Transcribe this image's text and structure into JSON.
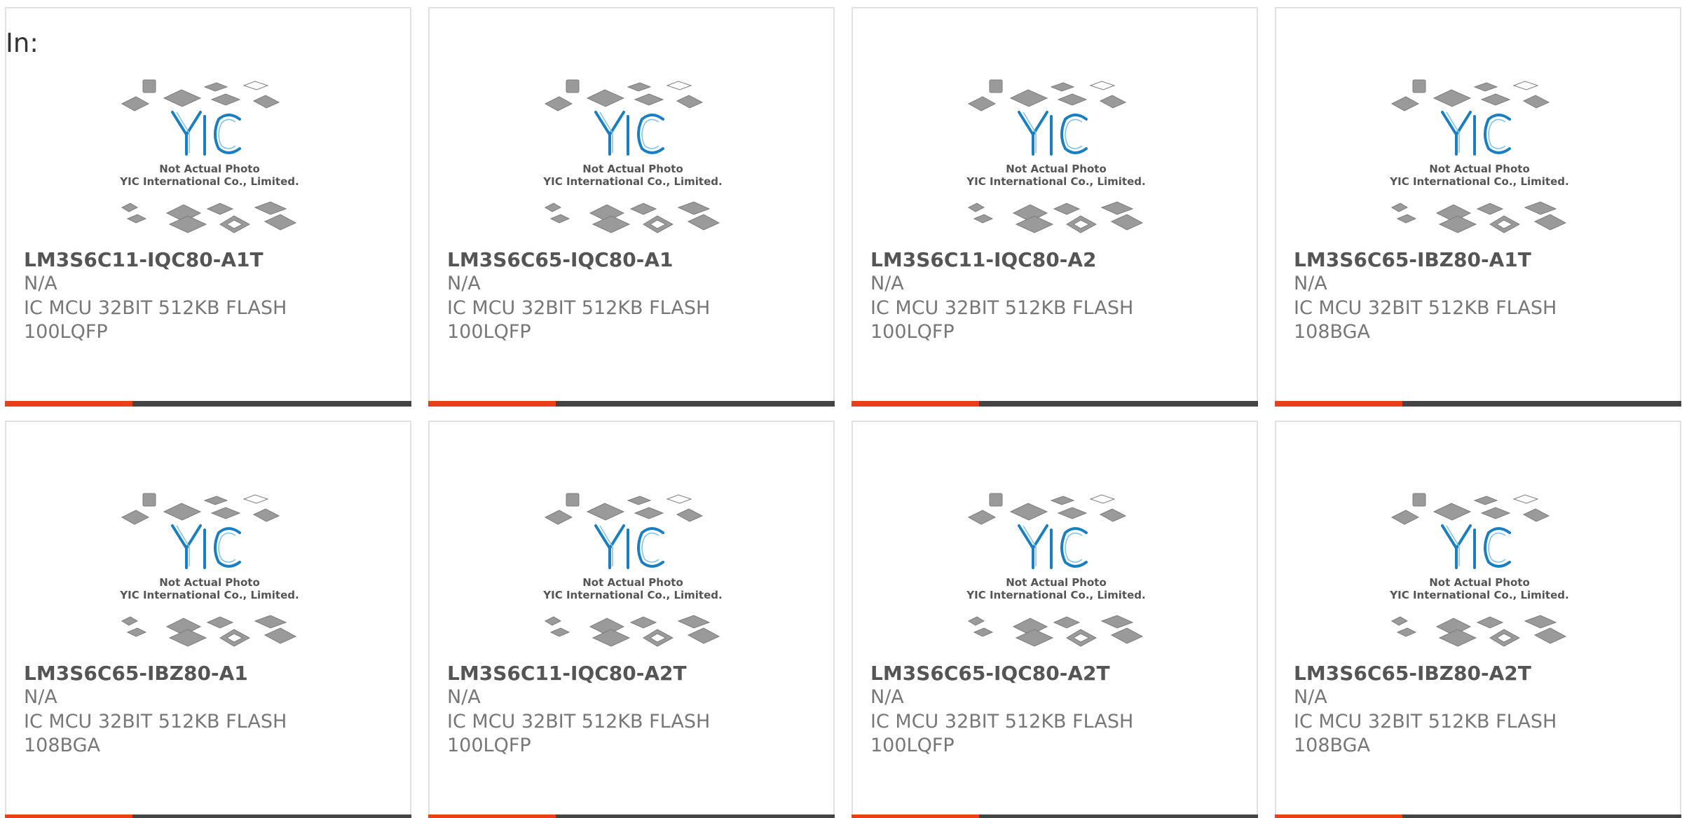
{
  "header": {
    "in_label": "In:"
  },
  "photo": {
    "line1": "Not Actual Photo",
    "line2": "YIC International Co., Limited.",
    "logo_text": "YIC"
  },
  "colors": {
    "accent": "#e8401a",
    "bar": "#444444",
    "logo": "#1a7fc0"
  },
  "products": [
    {
      "part": "LM3S6C11-IQC80-A1T",
      "mfr": "N/A",
      "desc1": "IC MCU 32BIT 512KB FLASH",
      "desc2": "100LQFP"
    },
    {
      "part": "LM3S6C65-IQC80-A1",
      "mfr": "N/A",
      "desc1": "IC MCU 32BIT 512KB FLASH",
      "desc2": "100LQFP"
    },
    {
      "part": "LM3S6C11-IQC80-A2",
      "mfr": "N/A",
      "desc1": "IC MCU 32BIT 512KB FLASH",
      "desc2": "100LQFP"
    },
    {
      "part": "LM3S6C65-IBZ80-A1T",
      "mfr": "N/A",
      "desc1": "IC MCU 32BIT 512KB FLASH",
      "desc2": "108BGA"
    },
    {
      "part": "LM3S6C65-IBZ80-A1",
      "mfr": "N/A",
      "desc1": "IC MCU 32BIT 512KB FLASH",
      "desc2": "108BGA"
    },
    {
      "part": "LM3S6C11-IQC80-A2T",
      "mfr": "N/A",
      "desc1": "IC MCU 32BIT 512KB FLASH",
      "desc2": "100LQFP"
    },
    {
      "part": "LM3S6C65-IQC80-A2T",
      "mfr": "N/A",
      "desc1": "IC MCU 32BIT 512KB FLASH",
      "desc2": "100LQFP"
    },
    {
      "part": "LM3S6C65-IBZ80-A2T",
      "mfr": "N/A",
      "desc1": "IC MCU 32BIT 512KB FLASH",
      "desc2": "108BGA"
    }
  ]
}
